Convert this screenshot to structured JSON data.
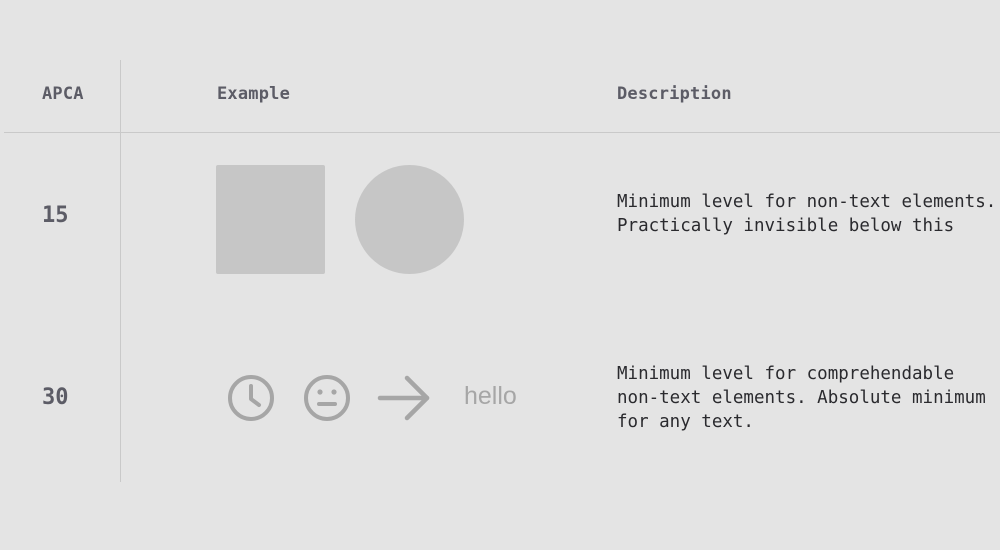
{
  "table": {
    "headers": {
      "apca": "APCA",
      "example": "Example",
      "description": "Description"
    },
    "rows": [
      {
        "level": "15",
        "example": {
          "shapes": [
            "square",
            "circle"
          ],
          "color": "#c6c6c6"
        },
        "description": "Minimum level for non-text elements. Practically invisible below this"
      },
      {
        "level": "30",
        "example": {
          "icons": [
            "clock-icon",
            "neutral-face-icon",
            "arrow-right-icon"
          ],
          "text": "hello",
          "color": "#a6a6a6"
        },
        "description": "Minimum level for comprehendable non-text elements. Absolute minimum for any text."
      }
    ]
  },
  "colors": {
    "background": "#e4e4e4",
    "divider": "#c9c9c9",
    "header_text": "#5c5c66",
    "body_text": "#2a2a2e"
  }
}
